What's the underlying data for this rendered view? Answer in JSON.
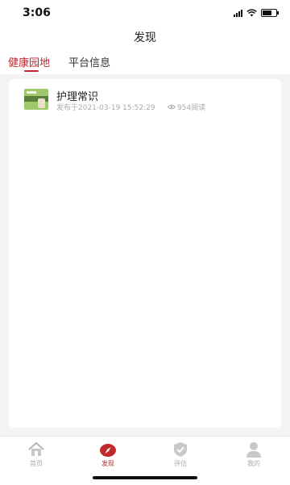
{
  "status_bar": {
    "time": "3:06",
    "battery_level": 0.7
  },
  "header": {
    "title": "发现"
  },
  "tabs": [
    {
      "label": "健康园地",
      "active": true
    },
    {
      "label": "平台信息",
      "active": false
    }
  ],
  "articles": [
    {
      "title": "护理常识",
      "published": "发布于2021-03-19 15:52:29",
      "views": "954阅读",
      "thumbnail_icon": "article-thumbnail"
    }
  ],
  "bottom_nav": [
    {
      "label": "首页",
      "icon": "home-icon",
      "active": false
    },
    {
      "label": "发现",
      "icon": "compass-icon",
      "active": true
    },
    {
      "label": "评估",
      "icon": "shield-check-icon",
      "active": false
    },
    {
      "label": "我的",
      "icon": "user-icon",
      "active": false
    }
  ],
  "colors": {
    "accent": "#c0282d",
    "background": "#f3f3f3",
    "inactive": "#aaaaaa"
  }
}
